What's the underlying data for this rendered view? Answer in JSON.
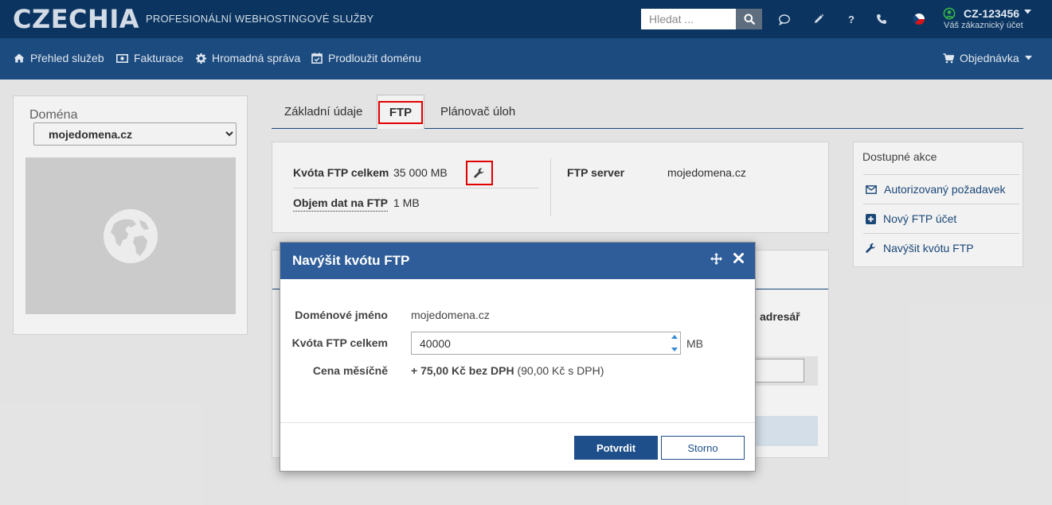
{
  "header": {
    "logo": "CZECHIA",
    "tagline": "PROFESIONÁLNÍ WEBHOSTINGOVÉ SLUŽBY",
    "search_placeholder": "Hledat ...",
    "user_id": "CZ-123456",
    "user_subtitle": "Váš zákaznický účet",
    "icons": [
      "search-icon",
      "chat-icon",
      "pencil-icon",
      "help-icon",
      "phone-icon",
      "czech-flag-icon",
      "user-icon",
      "caret-down-icon"
    ]
  },
  "nav": {
    "items": [
      {
        "label": "Přehled služeb",
        "icon": "home-icon"
      },
      {
        "label": "Fakturace",
        "icon": "money-icon"
      },
      {
        "label": "Hromadná správa",
        "icon": "gear-icon"
      },
      {
        "label": "Prodloužit doménu",
        "icon": "calendar-check-icon"
      }
    ],
    "order_label": "Objednávka",
    "order_icon": "cart-icon"
  },
  "sidebar": {
    "domain_label": "Doména",
    "selected_domain": "mojedomena.cz",
    "image_icon": "globe-icon"
  },
  "tabs": [
    {
      "label": "Základní údaje",
      "active": false
    },
    {
      "label": "FTP",
      "active": true
    },
    {
      "label": "Plánovač úloh",
      "active": false
    }
  ],
  "ftp_info": {
    "quota_label": "Kvóta FTP celkem",
    "quota_value": "35 000 MB",
    "volume_label": "Objem dat na FTP",
    "volume_value": "1 MB",
    "server_label": "FTP server",
    "server_value": "mojedomena.cz"
  },
  "background_card": {
    "partial_heading": "adresář"
  },
  "actions": {
    "title": "Dostupné akce",
    "items": [
      {
        "label": "Autorizovaný požadavek",
        "icon": "envelope-icon"
      },
      {
        "label": "Nový FTP účet",
        "icon": "plus-square-icon"
      },
      {
        "label": "Navýšit kvótu FTP",
        "icon": "wrench-icon"
      }
    ]
  },
  "modal": {
    "title": "Navýšit kvótu FTP",
    "domain_label": "Doménové jméno",
    "domain_value": "mojedomena.cz",
    "quota_label": "Kvóta FTP celkem",
    "quota_value": "40000",
    "quota_unit": "MB",
    "price_label": "Cena měsíčně",
    "price_main": "+ 75,00 Kč bez DPH",
    "price_vat": "(90,00 Kč s DPH)",
    "confirm_label": "Potvrdit",
    "cancel_label": "Storno"
  },
  "colors": {
    "topbar": "#0b3560",
    "navbar": "#1c4b7f",
    "modal_header": "#2e5d9a",
    "primary_button": "#1e4f8a",
    "highlight": "#e00000"
  }
}
